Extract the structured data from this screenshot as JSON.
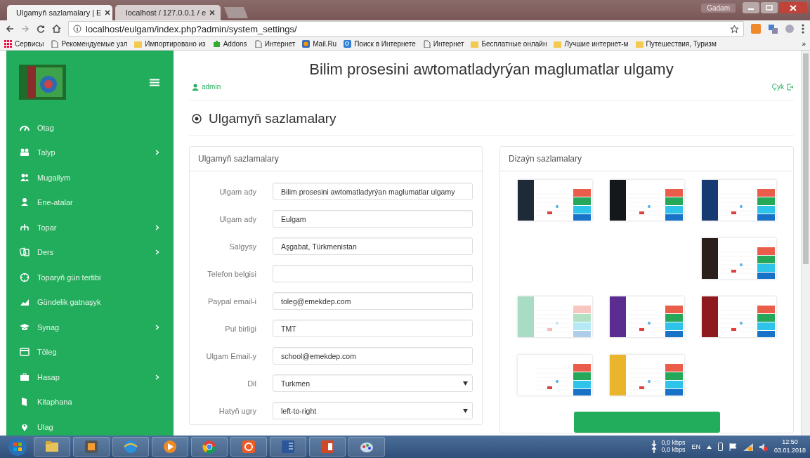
{
  "browser": {
    "tabs": [
      {
        "title": "Ulgamyň sazlamalary | E",
        "selected": true
      },
      {
        "title": "localhost / 127.0.0.1 / e",
        "selected": false
      }
    ],
    "user_button": "Gadam",
    "url": "localhost/eulgam/index.php?admin/system_settings/",
    "bookmarks": [
      "Сервисы",
      "Рекомендуемые узл",
      "Импортировано из",
      "Addons",
      "Интернет",
      "Mail.Ru",
      "Поиск в Интернете",
      "Интернет",
      "Бесплатные онлайн",
      "Лучшие интернет-м",
      "Путешествия, Туризм"
    ],
    "bookmarks_more": "»"
  },
  "sidebar": {
    "items": [
      {
        "label": "Otag",
        "has_submenu": false
      },
      {
        "label": "Talyp",
        "has_submenu": true
      },
      {
        "label": "Mugallym",
        "has_submenu": false
      },
      {
        "label": "Ene-atalar",
        "has_submenu": false
      },
      {
        "label": "Topar",
        "has_submenu": true
      },
      {
        "label": "Ders",
        "has_submenu": true
      },
      {
        "label": "Toparyň gün tertibi",
        "has_submenu": false
      },
      {
        "label": "Gündelik gatnaşyk",
        "has_submenu": false
      },
      {
        "label": "Synag",
        "has_submenu": true
      },
      {
        "label": "Töleg",
        "has_submenu": false
      },
      {
        "label": "Hasap",
        "has_submenu": true
      },
      {
        "label": "Kitaphana",
        "has_submenu": false
      },
      {
        "label": "Ulag",
        "has_submenu": false
      }
    ]
  },
  "header": {
    "title": "Bilim prosesini awtomatladyrýan maglumatlar ulgamy",
    "user": "admin",
    "logout": "Çyk"
  },
  "page_title": "Ulgamyň sazlamalary",
  "system_panel": {
    "title": "Ulgamyň sazlamalary",
    "fields": [
      {
        "label": "Ulgam ady",
        "kind": "text",
        "value": "Bilim prosesini awtomatladyrýan maglumatlar ulgamy"
      },
      {
        "label": "Ulgam ady",
        "kind": "text",
        "value": "Eulgam"
      },
      {
        "label": "Salgysy",
        "kind": "text",
        "value": "Aşgabat, Türkmenistan"
      },
      {
        "label": "Telefon belgisi",
        "kind": "text"
      },
      {
        "label": "Paypal email-i",
        "kind": "text",
        "value": "toleg@emekdep.com"
      },
      {
        "label": "Pul birligi",
        "kind": "text",
        "value": "TMT"
      },
      {
        "label": "Ulgam Email-y",
        "kind": "text",
        "value": "school@emekdep.com"
      },
      {
        "label": "Dil",
        "kind": "select",
        "value": "Turkmen"
      },
      {
        "label": "Hatyň ugry",
        "kind": "select",
        "value": "left-to-right"
      }
    ]
  },
  "design_panel": {
    "title": "Dizaýn sazlamalary",
    "rows": [
      [
        {
          "kind": "theme",
          "color": "#1e2a38",
          "faded": false
        },
        {
          "kind": "theme",
          "color": "#14181c",
          "faded": false
        },
        {
          "kind": "theme",
          "color": "#163a72",
          "faded": false
        }
      ],
      [
        {
          "kind": "empty"
        },
        {
          "kind": "empty"
        },
        {
          "kind": "theme",
          "color": "#2a1f1a",
          "faded": false
        }
      ],
      [
        {
          "kind": "theme",
          "color": "#a8dcc4",
          "faded": true
        },
        {
          "kind": "theme",
          "color": "#5c2d91",
          "faded": false
        },
        {
          "kind": "theme",
          "color": "#8e1a1e",
          "faded": false
        }
      ],
      [
        {
          "kind": "theme",
          "color": "#ffffff",
          "faded": false
        },
        {
          "kind": "theme",
          "color": "#e8b52c",
          "faded": false
        }
      ]
    ]
  },
  "taskbar": {
    "download": "0,0 kbps",
    "upload": "0,0 kbps",
    "language": "EN",
    "time": "12:50",
    "date": "03.01.2018"
  }
}
